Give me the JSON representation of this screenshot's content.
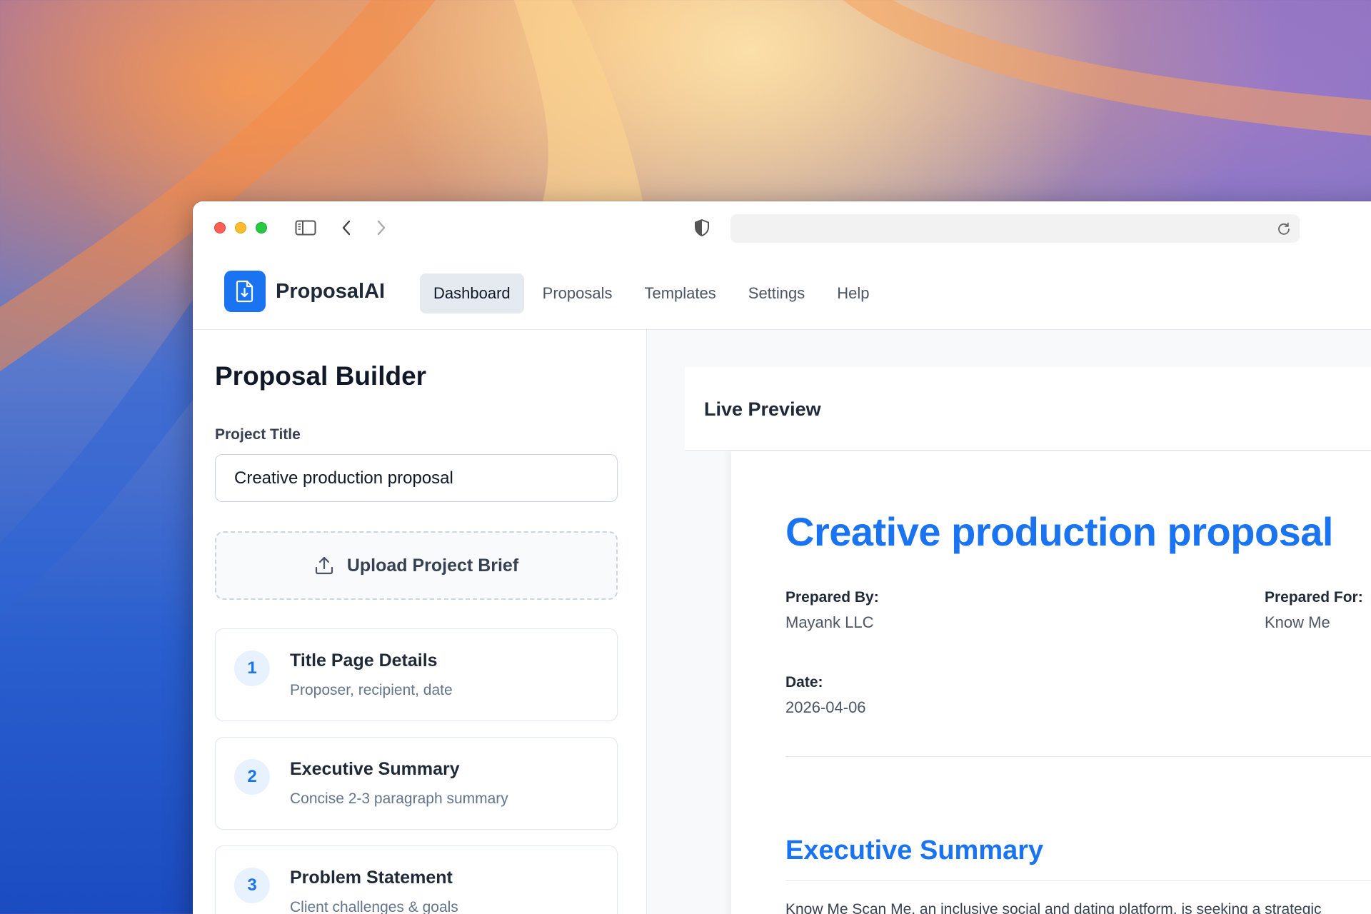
{
  "browser": {
    "url": ""
  },
  "header": {
    "brand": "ProposalAI",
    "nav": [
      {
        "label": "Dashboard",
        "active": true
      },
      {
        "label": "Proposals",
        "active": false
      },
      {
        "label": "Templates",
        "active": false
      },
      {
        "label": "Settings",
        "active": false
      },
      {
        "label": "Help",
        "active": false
      }
    ]
  },
  "builder": {
    "title": "Proposal Builder",
    "project_title_label": "Project Title",
    "project_title_value": "Creative production proposal",
    "upload_label": "Upload Project Brief",
    "steps": [
      {
        "number": "1",
        "title": "Title Page Details",
        "subtitle": "Proposer, recipient, date"
      },
      {
        "number": "2",
        "title": "Executive Summary",
        "subtitle": "Concise 2-3 paragraph summary"
      },
      {
        "number": "3",
        "title": "Problem Statement",
        "subtitle": "Client challenges & goals"
      }
    ]
  },
  "preview": {
    "header": "Live Preview",
    "doc_title": "Creative production proposal",
    "prepared_by_label": "Prepared By:",
    "prepared_by_value": "Mayank LLC",
    "prepared_for_label": "Prepared For:",
    "prepared_for_value": "Know Me",
    "date_label": "Date:",
    "date_value": "2026-04-06",
    "section_title": "Executive Summary",
    "section_body": "Know Me Scan Me, an inclusive social and dating platform, is seeking a strategic"
  },
  "colors": {
    "accent": "#1a73f0",
    "nav_active_bg": "#e5e9f0"
  }
}
